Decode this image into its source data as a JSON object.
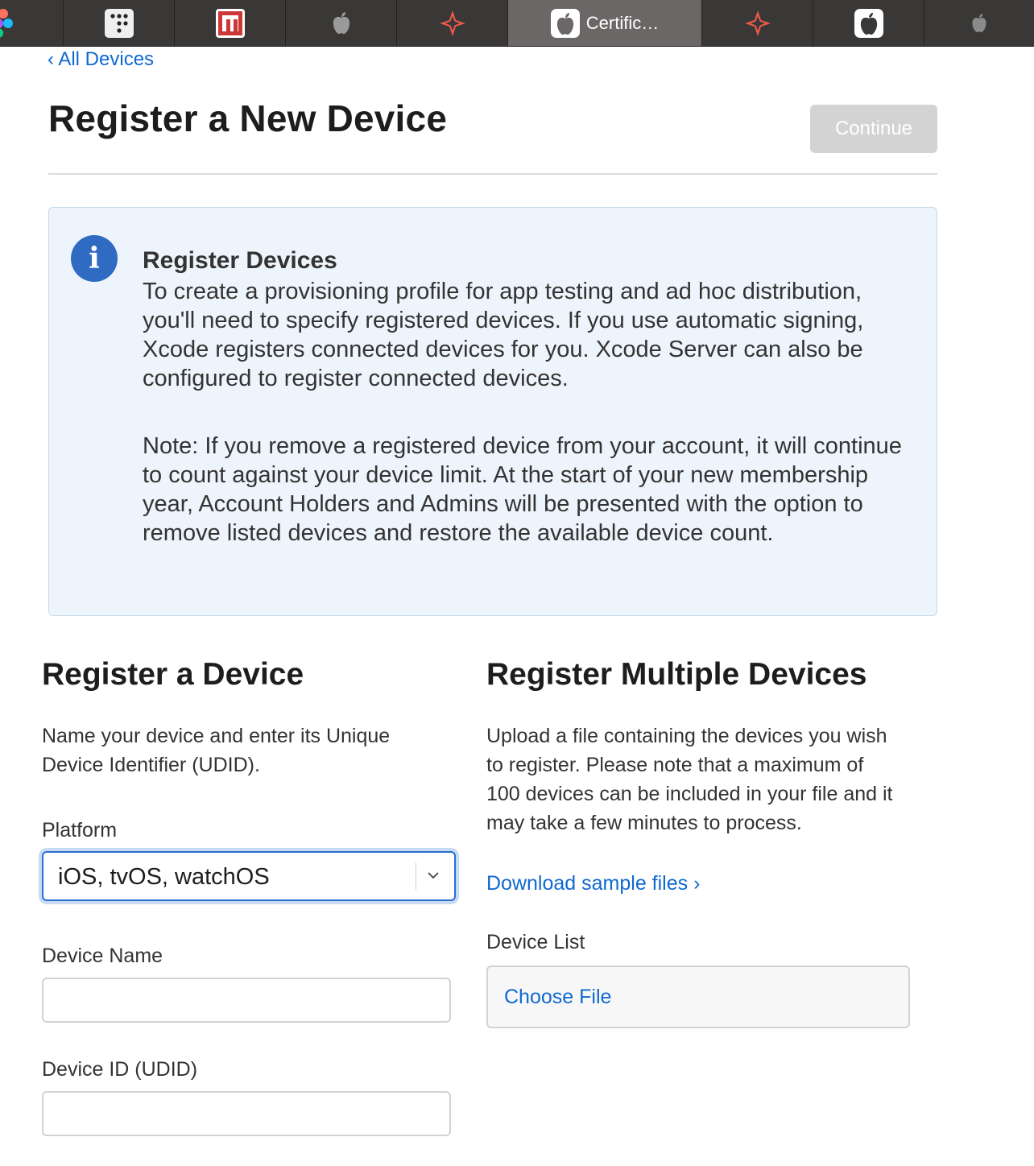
{
  "tabs": [
    {
      "icon": "figma-icon",
      "title": ""
    },
    {
      "icon": "dice-grid-icon",
      "title": ""
    },
    {
      "icon": "npm-icon",
      "title": ""
    },
    {
      "icon": "apple-icon",
      "title": ""
    },
    {
      "icon": "sparkle-icon",
      "title": ""
    },
    {
      "icon": "apple-icon",
      "title": "Certific…",
      "active": true
    },
    {
      "icon": "sparkle-icon",
      "title": ""
    },
    {
      "icon": "apple-icon",
      "title": ""
    },
    {
      "icon": "apple-icon",
      "title": ""
    }
  ],
  "header": {
    "back_link": "‹ All Devices",
    "title": "Register a New Device",
    "continue_label": "Continue"
  },
  "info": {
    "heading": "Register Devices",
    "paragraph1": "To create a provisioning profile for app testing and ad hoc distribution, you'll need to specify registered devices. If you use automatic signing, Xcode registers connected devices for you. Xcode Server can also be configured to register connected devices.",
    "paragraph2": "Note: If you remove a registered device from your account, it will continue to count against your device limit. At the start of your new membership year, Account Holders and Admins will be presented with the option to remove listed devices and restore the available device count."
  },
  "single": {
    "title": "Register a Device",
    "description": "Name your device and enter its Unique Device Identifier (UDID).",
    "platform_label": "Platform",
    "platform_value": "iOS, tvOS, watchOS",
    "device_name_label": "Device Name",
    "device_name_value": "",
    "device_id_label": "Device ID (UDID)",
    "device_id_value": ""
  },
  "multiple": {
    "title": "Register Multiple Devices",
    "description": "Upload a file containing the devices you wish to register. Please note that a maximum of 100 devices can be included in your file and it may take a few minutes to process.",
    "sample_link": "Download sample files ›",
    "device_list_label": "Device List",
    "choose_file_label": "Choose File"
  },
  "colors": {
    "link": "#0f69d1",
    "tabbar": "#3a3837",
    "active_tab": "#6a6766",
    "info_bg": "#eef4fb",
    "info_icon": "#2f6ac3"
  }
}
